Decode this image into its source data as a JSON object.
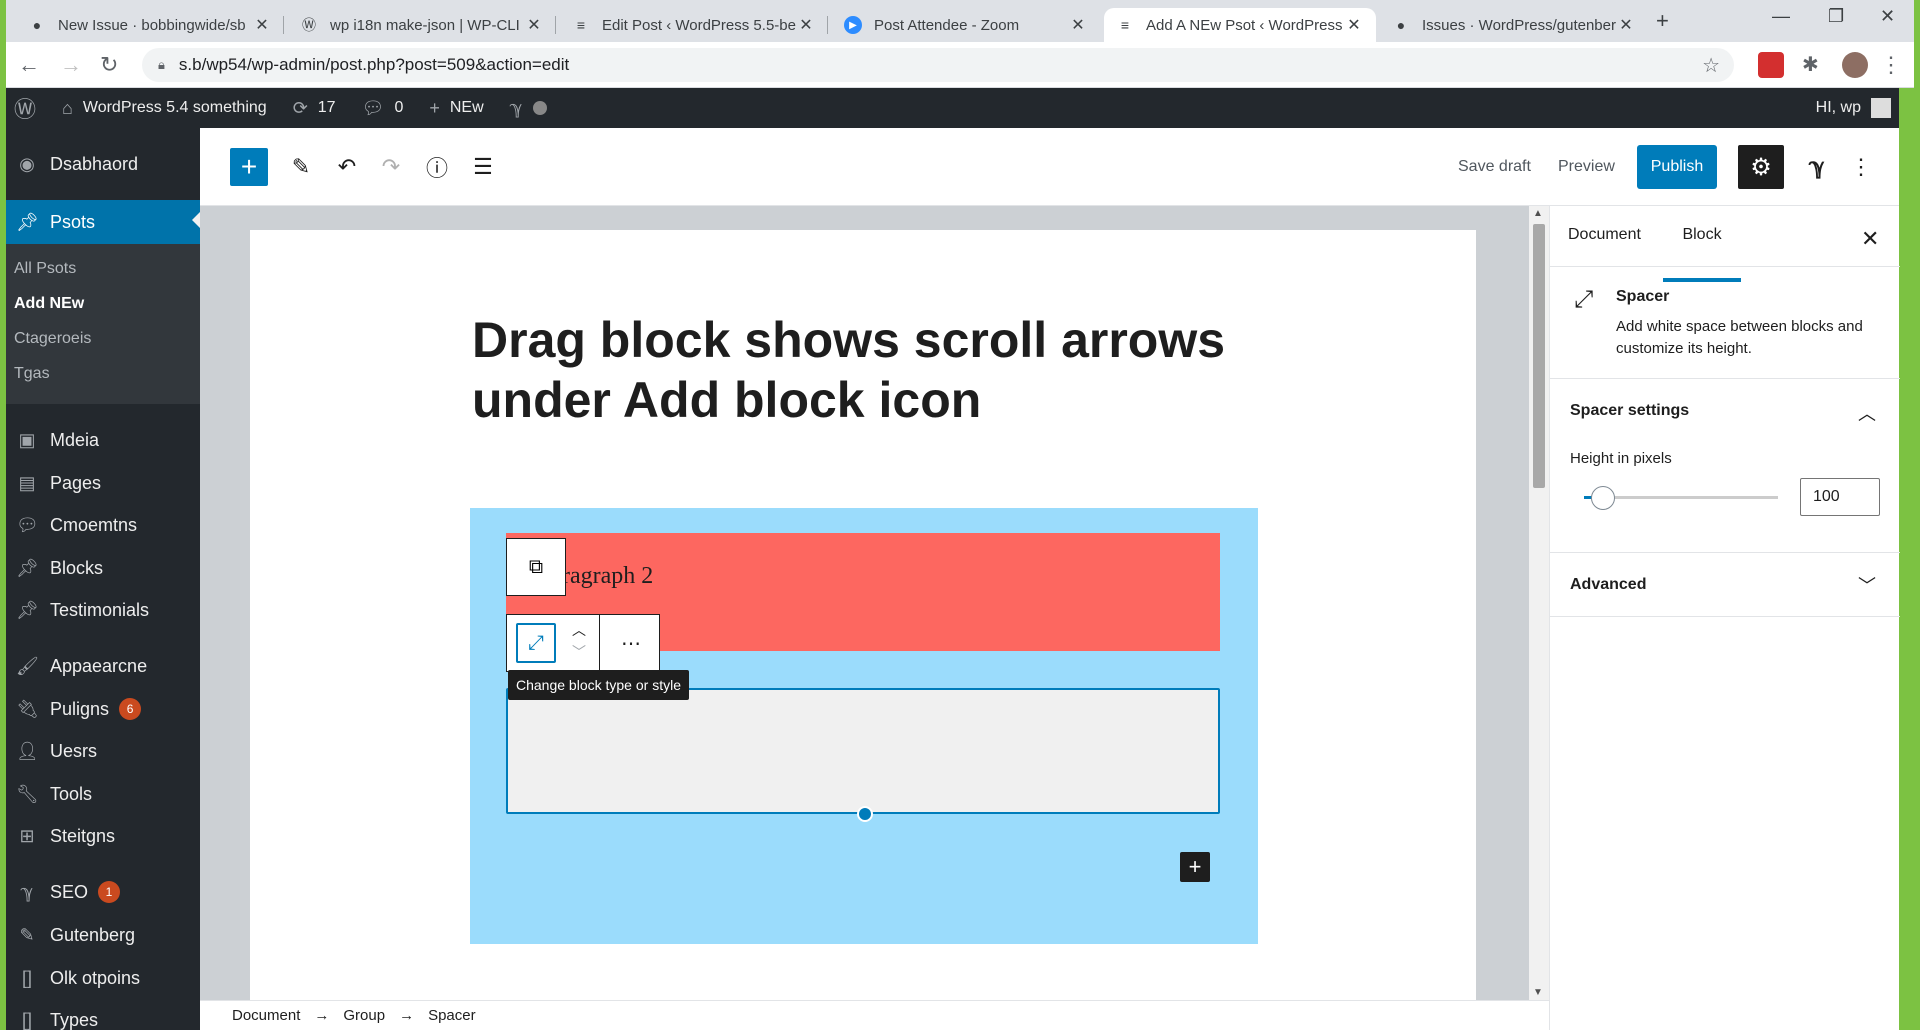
{
  "browser": {
    "tabs": [
      {
        "title": "New Issue · bobbingwide/sb",
        "icon": "github-icon"
      },
      {
        "title": "wp i18n make-json | WP-CLI",
        "icon": "wordpress-icon"
      },
      {
        "title": "Edit Post ‹ WordPress 5.5-be",
        "icon": "site-icon"
      },
      {
        "title": "Post Attendee - Zoom",
        "icon": "zoom-icon"
      },
      {
        "title": "Add A NEw Psot ‹ WordPress",
        "icon": "site-icon"
      },
      {
        "title": "Issues · WordPress/gutenber",
        "icon": "github-icon"
      }
    ],
    "url": "s.b/wp54/wp-admin/post.php?post=509&action=edit"
  },
  "adminbar": {
    "site_name": "WordPress 5.4 something",
    "updates": "17",
    "comments": "0",
    "new_label": "NEw",
    "greeting": "HI, wp"
  },
  "menu": {
    "dashboard": "Dsabhaord",
    "posts": "Psots",
    "sub": [
      "All Psots",
      "Add NEw",
      "Ctageroeis",
      "Tgas"
    ],
    "media": "Mdeia",
    "pages": "Pages",
    "comments": "Cmoemtns",
    "blocks": "Blocks",
    "testimonials": "Testimonials",
    "appearance": "Appaearcne",
    "plugins": "Puligns",
    "plugins_badge": "6",
    "users": "Uesrs",
    "tools": "Tools",
    "settings": "Steitgns",
    "seo": "SEO",
    "seo_badge": "1",
    "gutenberg": "Gutenberg",
    "oik_options": "Olk otpoins",
    "types": "Types"
  },
  "header": {
    "save_draft": "Save draft",
    "preview": "Preview",
    "publish": "Publish"
  },
  "editor": {
    "title": "Drag block shows scroll arrows under Add block icon",
    "paragraph_text": "ragraph 2",
    "tooltip": "Change block type or style"
  },
  "sidebar": {
    "tab_document": "Document",
    "tab_block": "Block",
    "block_name": "Spacer",
    "block_desc": "Add white space between blocks and customize its height.",
    "spacer_settings": "Spacer settings",
    "height_label": "Height in pixels",
    "height_value": "100",
    "height_level_fraction": 0.1,
    "advanced": "Advanced"
  },
  "breadcrumb": [
    "Document",
    "Group",
    "Spacer"
  ],
  "colors": {
    "accent": "#007cba",
    "admin_bg": "#23282d",
    "group_bg": "#9bdcfc",
    "paragraph_bg": "#fd6760"
  }
}
